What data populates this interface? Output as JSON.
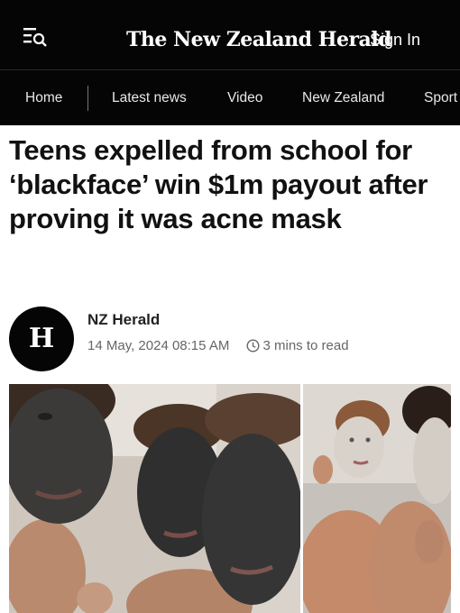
{
  "header": {
    "menu_icon": "menu-search-icon",
    "masthead": "The New Zealand Herald",
    "sign_in": "Sign In"
  },
  "nav": {
    "items": [
      "Home",
      "Latest news",
      "Video",
      "New Zealand",
      "Sport"
    ]
  },
  "article": {
    "headline": "Teens expelled from school for ‘blackface’ win $1m payout after proving it was acne mask",
    "author_avatar": "H",
    "author": "NZ Herald",
    "date": "14 May, 2024 08:15 AM",
    "read_time": "3 mins to read",
    "clock_icon": "clock-icon"
  },
  "colors": {
    "header_bg": "#050505",
    "header_text": "#ffffff",
    "headline": "#111111",
    "meta": "#666666"
  }
}
